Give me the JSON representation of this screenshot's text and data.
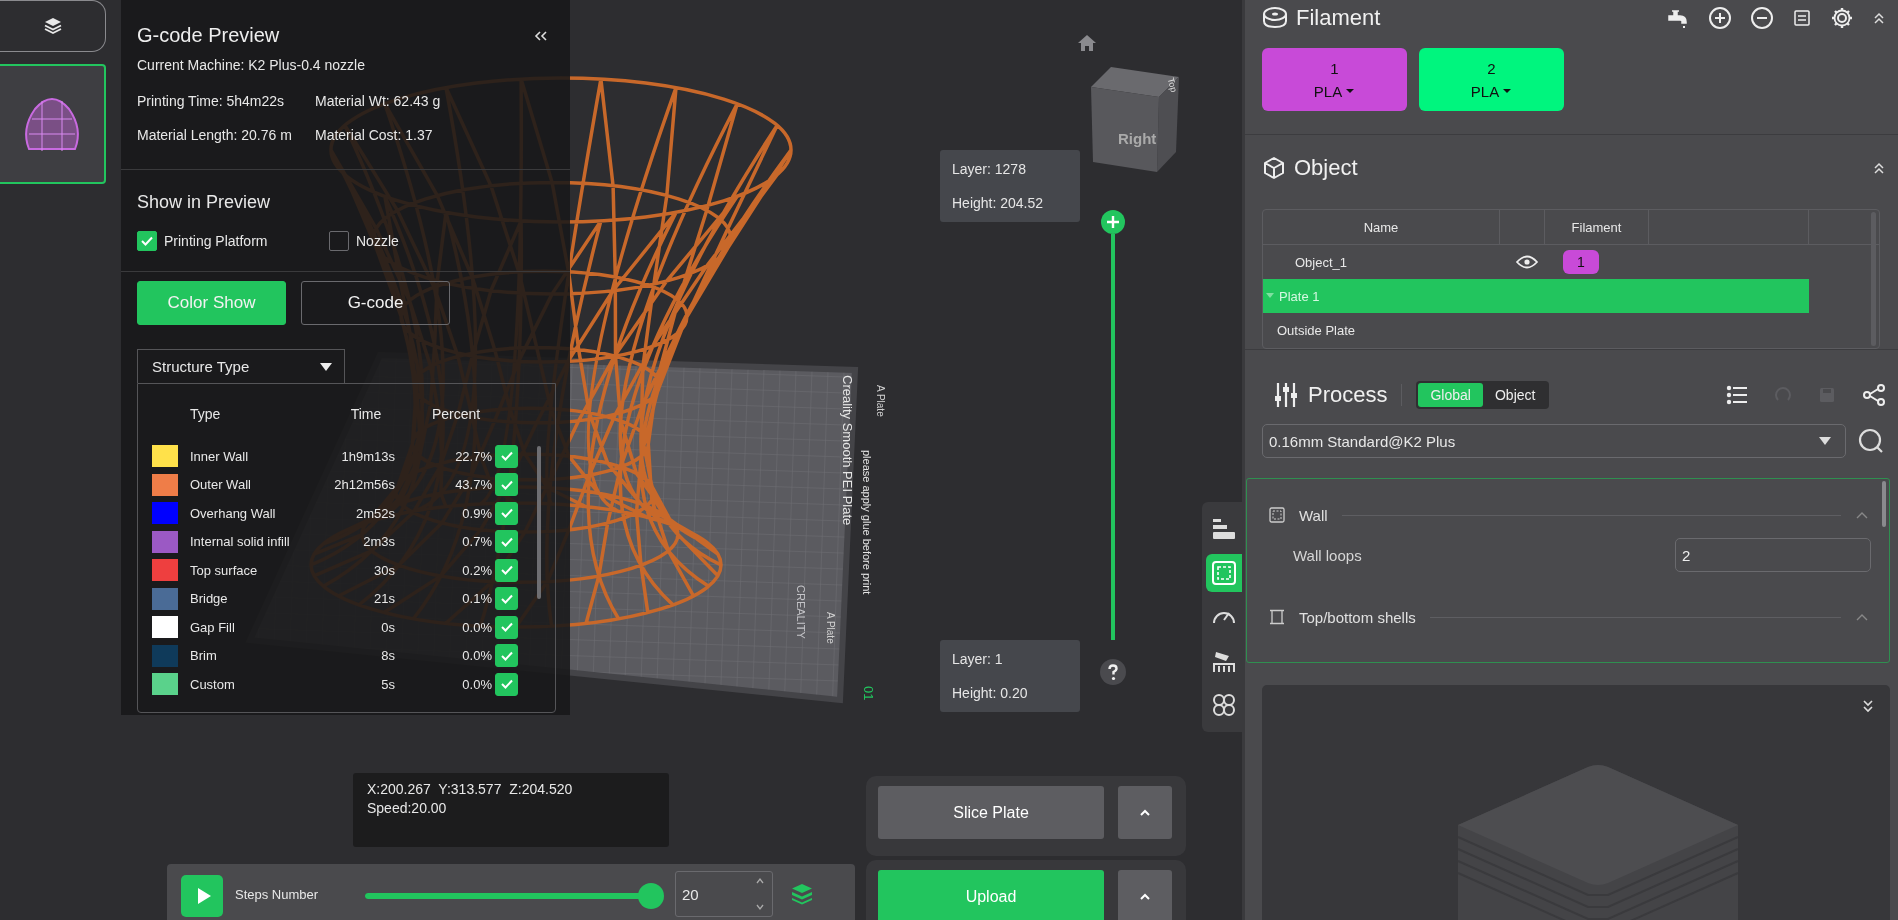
{
  "sidebar": {
    "thumbnails": [
      {
        "selected": true
      }
    ]
  },
  "gcode_preview": {
    "title": "G-code Preview",
    "machine": "Current Machine: K2 Plus-0.4 nozzle",
    "stats": [
      "Printing Time: 5h4m22s",
      "Material Wt: 62.43 g",
      "Material Length: 20.76 m",
      "Material Cost: 1.37"
    ],
    "show_title": "Show in Preview",
    "options": [
      {
        "label": "Printing Platform",
        "checked": true
      },
      {
        "label": "Nozzle",
        "checked": false
      }
    ],
    "view_buttons": [
      {
        "label": "Color Show",
        "selected": true
      },
      {
        "label": "G-code",
        "selected": false
      }
    ],
    "structure_dropdown": "Structure Type",
    "columns": [
      "Type",
      "Time",
      "Percent"
    ],
    "legend": [
      {
        "name": "Inner Wall",
        "time": "1h9m13s",
        "percent": "22.7%",
        "color": "#ffe14a",
        "visible": true
      },
      {
        "name": "Outer Wall",
        "time": "2h12m56s",
        "percent": "43.7%",
        "color": "#ef7d48",
        "visible": true
      },
      {
        "name": "Overhang Wall",
        "time": "2m52s",
        "percent": "0.9%",
        "color": "#0000ff",
        "visible": true
      },
      {
        "name": "Internal solid infill",
        "time": "2m3s",
        "percent": "0.7%",
        "color": "#9b59c4",
        "visible": true
      },
      {
        "name": "Top surface",
        "time": "30s",
        "percent": "0.2%",
        "color": "#ee3f3f",
        "visible": true
      },
      {
        "name": "Bridge",
        "time": "21s",
        "percent": "0.1%",
        "color": "#4a6b96",
        "visible": true
      },
      {
        "name": "Gap Fill",
        "time": "0s",
        "percent": "0.0%",
        "color": "#ffffff",
        "visible": true
      },
      {
        "name": "Brim",
        "time": "8s",
        "percent": "0.0%",
        "color": "#0f3a5a",
        "visible": true
      },
      {
        "name": "Custom",
        "time": "5s",
        "percent": "0.0%",
        "color": "#5ad28b",
        "visible": true
      }
    ]
  },
  "viewport": {
    "cube": {
      "front": "Right",
      "top": "Top"
    },
    "plate_labels": [
      "Creality Smooth PEI Plate",
      "please apply glue before print",
      "A Plate",
      "A Plate",
      "01",
      "CREALITY"
    ],
    "layer_top": {
      "layer": "Layer: 1278",
      "height": "Height: 204.52"
    },
    "layer_bottom": {
      "layer": "Layer: 1",
      "height": "Height: 0.20"
    },
    "coordinates": [
      "X:200.267  Y:313.577  Z:204.520",
      "Speed:20.00"
    ]
  },
  "steps": {
    "label": "Steps Number",
    "level": 1,
    "value": "20"
  },
  "actions": [
    {
      "label": "Slice Plate",
      "kind": "secondary"
    },
    {
      "label": "Upload",
      "kind": "primary"
    }
  ],
  "tool_strip": [
    {
      "selected": false
    },
    {
      "selected": true
    },
    {
      "selected": false
    },
    {
      "selected": false
    },
    {
      "selected": false
    }
  ],
  "filament": {
    "title": "Filament",
    "chips": [
      {
        "number": "1",
        "material": "PLA",
        "color": "#c84ad8"
      },
      {
        "number": "2",
        "material": "PLA",
        "color": "#00f57e"
      }
    ]
  },
  "object": {
    "title": "Object",
    "columns": [
      "Name",
      "Filament"
    ],
    "rows": [
      {
        "kind": "object",
        "name": "Object_1",
        "filament": "1",
        "color": "#c84ad8",
        "selected": false
      },
      {
        "kind": "plate",
        "name": "Plate 1",
        "expanded": true,
        "selected": true
      },
      {
        "kind": "outside",
        "name": "Outside Plate",
        "selected": false
      }
    ]
  },
  "process": {
    "title": "Process",
    "modes": [
      {
        "label": "Global",
        "selected": true
      },
      {
        "label": "Object",
        "selected": false
      }
    ],
    "preset": "0.16mm Standard@K2 Plus",
    "sections": [
      {
        "title": "Wall",
        "kind": "wall",
        "settings": [
          {
            "label": "Wall loops",
            "value": "2"
          }
        ]
      },
      {
        "title": "Top/bottom shells",
        "kind": "shells"
      }
    ]
  }
}
